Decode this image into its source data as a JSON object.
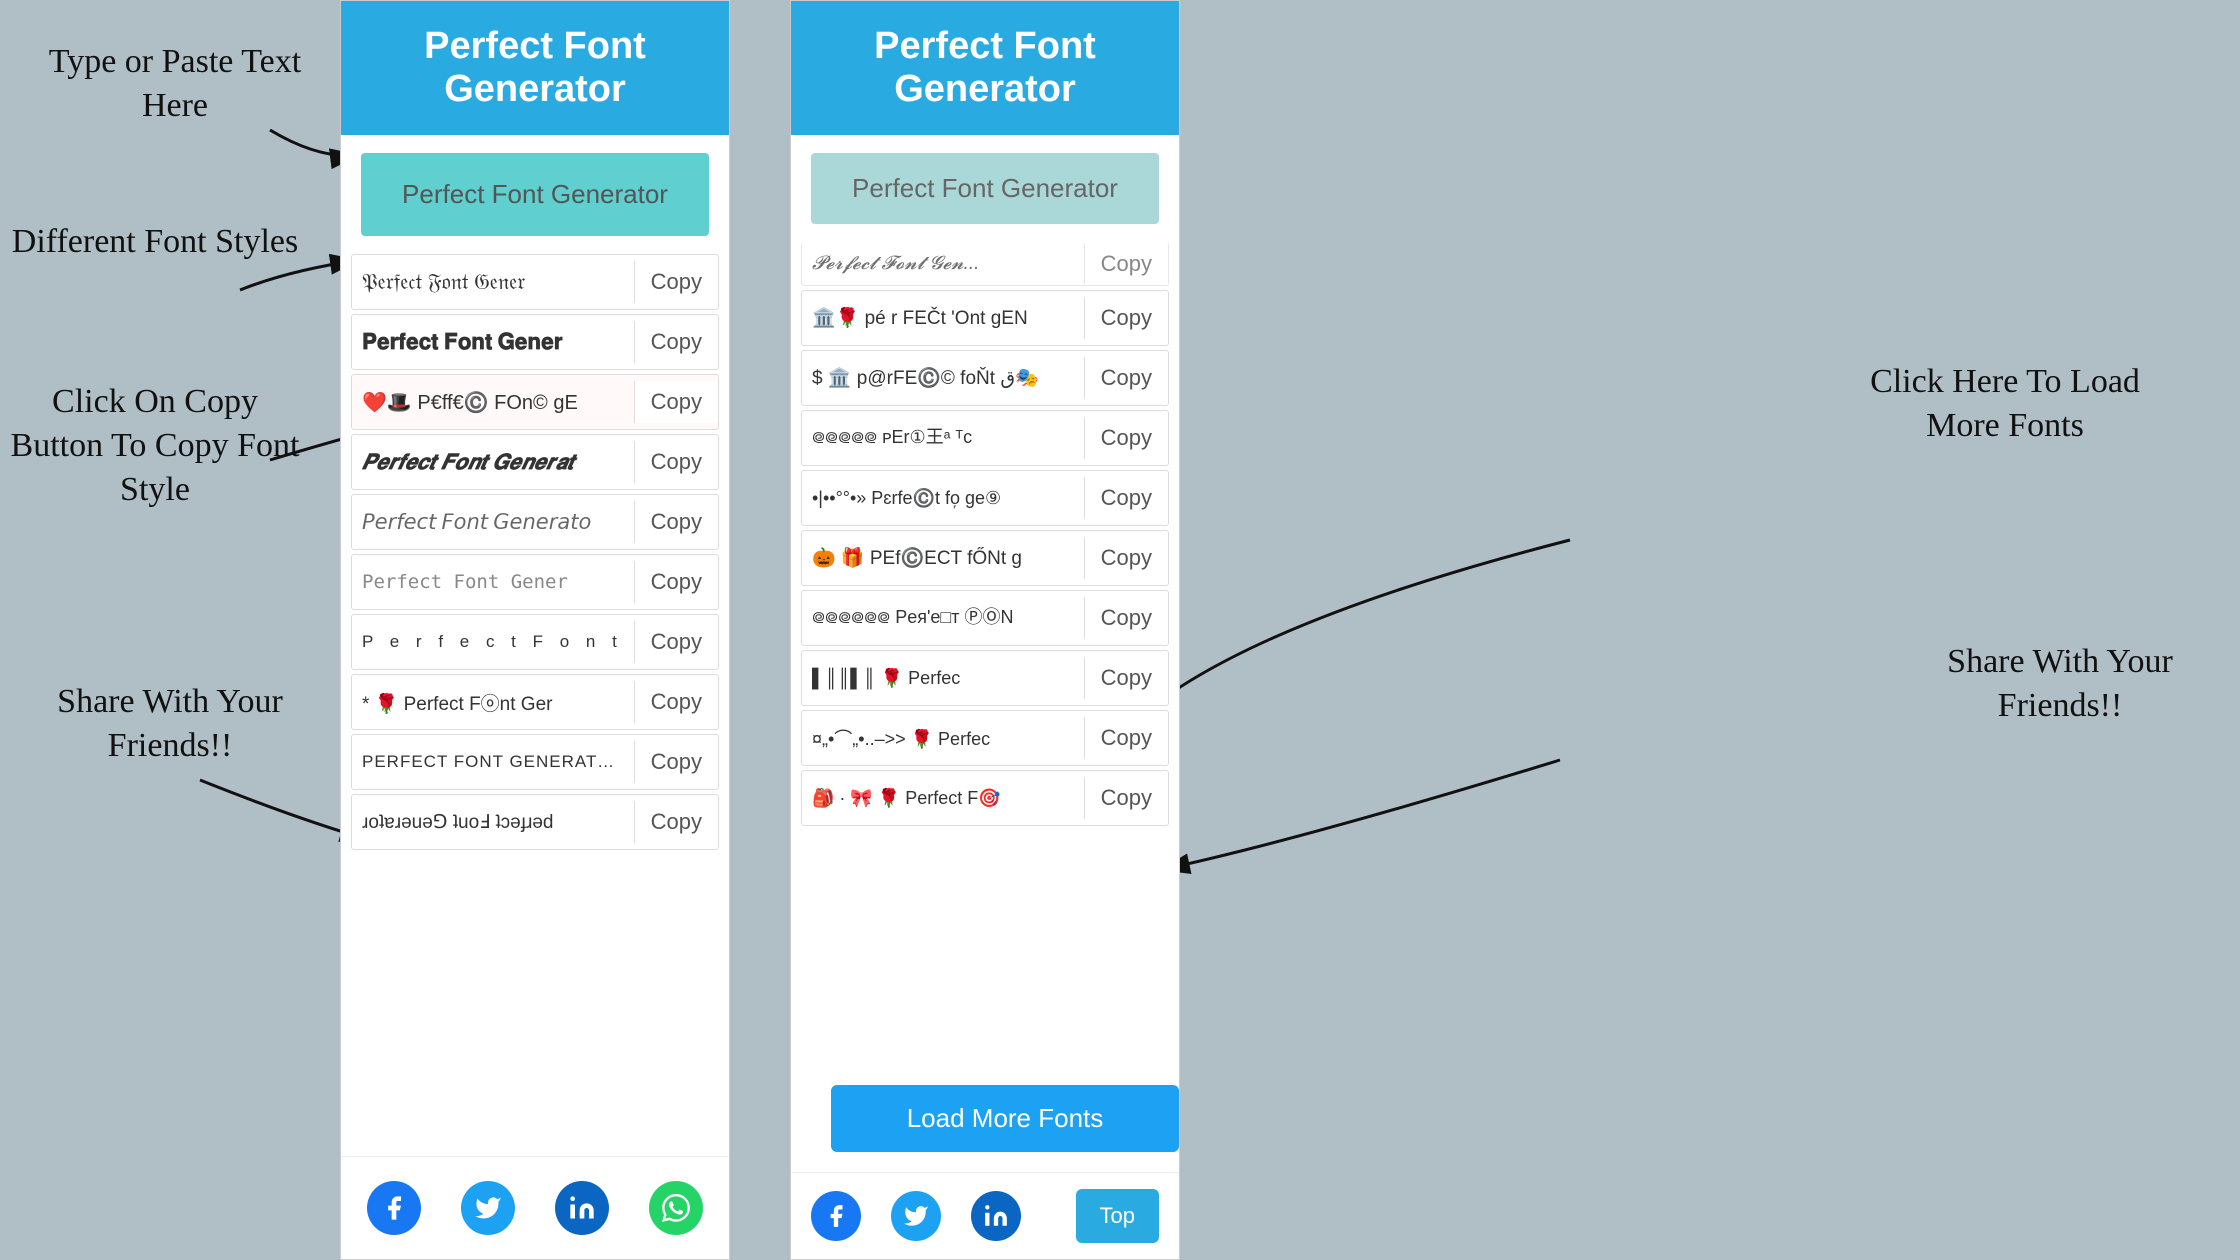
{
  "app": {
    "title": "Perfect Font Generator",
    "input_placeholder": "Perfect Font Generator",
    "header_color": "#29abe2",
    "bg_color": "#b0bec5"
  },
  "annotations": {
    "type_paste": "Type or Paste Text Here",
    "diff_fonts": "Different Font Styles",
    "click_copy": "Click On Copy Button To Copy Font Style",
    "share": "Share With Your Friends!!",
    "load_more": "Click Here To Load More Fonts",
    "share2": "Share With Your Friends!!"
  },
  "left_panel": {
    "header": "Perfect Font Generator",
    "input_value": "Perfect Font Generator",
    "fonts": [
      {
        "text": "𝔓𝔢𝔯𝔣𝔢𝔠𝔱 𝔉𝔬𝔫𝔱 𝔊𝔢𝔫𝔢𝔯𝔞𝔱𝔬𝔯",
        "style": "fraktur",
        "copy": "Copy"
      },
      {
        "text": "𝐏𝐞𝐫𝐟𝐞𝐜𝐭 𝐅𝐨𝐧𝐭 𝐆𝐞𝐧𝐞𝐫𝐚𝐭𝐨𝐫",
        "style": "bold-serif",
        "copy": "Copy"
      },
      {
        "text": "❤️🎩 P€ff€©️ FOn© gE",
        "style": "emoji",
        "copy": "Copy"
      },
      {
        "text": "𝑷𝒆𝒓𝒇𝒆𝒄𝒕 𝑭𝒐𝒏𝒕 𝑮𝒆𝒏𝒆𝒓𝒂𝒕",
        "style": "bold-italic",
        "copy": "Copy"
      },
      {
        "text": "𝘗𝘦𝘳𝘧𝘦𝘤𝘵 𝘍𝘰𝘯𝘵 𝘎𝘦𝘯𝘦𝘳𝘢𝘵𝘰",
        "style": "sans-italic",
        "copy": "Copy"
      },
      {
        "text": "𝙿𝚎𝚛𝚏𝚎𝚌𝚝 𝙵𝚘𝚗𝚝 𝙶𝚎𝚗𝚎𝚛",
        "style": "mono",
        "copy": "Copy"
      },
      {
        "text": "P e r f e c t  F o n t",
        "style": "spaced",
        "copy": "Copy"
      },
      {
        "text": "* 🌹 Perfect Fⓞnt Ger",
        "style": "emoji2",
        "copy": "Copy"
      },
      {
        "text": "PERFECT FONT GENERATOR",
        "style": "uppercase",
        "copy": "Copy"
      },
      {
        "text": "ɹoʇɐɹǝuǝ⅁ ʇuoℲ ʇɔǝɟɹǝd",
        "style": "flipped",
        "copy": "Copy"
      }
    ],
    "share_icons": [
      "facebook",
      "twitter",
      "linkedin",
      "whatsapp"
    ]
  },
  "right_panel": {
    "header": "Perfect Font Generator",
    "input_value": "Perfect Font Generator",
    "fonts": [
      {
        "text": "𝓟𝓮𝓻𝓯𝓮𝓬𝓽 𝓕𝓸𝓷𝓽 𝓖𝓮𝓷...",
        "style": "script",
        "copy": "Copy"
      },
      {
        "text": "🏛️🌹 pé r FEČt 'Ont gEN",
        "style": "emoji3",
        "copy": "Copy"
      },
      {
        "text": "$ 🏛️ p@rFE©️© foŇt ق🎭",
        "style": "emoji4",
        "copy": "Copy"
      },
      {
        "text": "᪤᪤᪤᪤᪤ ᴘEr①王ᵃ ᵀc",
        "style": "special1",
        "copy": "Copy"
      },
      {
        "text": "•|••°°•» Pɛrfe©️t fo᷊ ge⑨",
        "style": "special2",
        "copy": "Copy"
      },
      {
        "text": "🎃 🎁 PEf©️ECT fŐNt g",
        "style": "emoji5",
        "copy": "Copy"
      },
      {
        "text": "᪤᪤᪤᪤᪤᪤ Pея'e□т ⓅⓄN",
        "style": "special3",
        "copy": "Copy"
      },
      {
        "text": "▌║║▌║ 🌹 Perfec",
        "style": "barcode",
        "copy": "Copy"
      },
      {
        "text": "¤„•⌒„•..–>> 🌹 Perfec",
        "style": "special4",
        "copy": "Copy"
      },
      {
        "text": "🎒 · 🎀 🌹 Perfect F🎯",
        "style": "emoji6",
        "copy": "Copy"
      }
    ],
    "load_more_label": "Load More Fonts",
    "top_label": "Top",
    "share_icons": [
      "facebook",
      "twitter",
      "linkedin"
    ]
  },
  "copy_label": "Copy",
  "colors": {
    "header": "#29abe2",
    "input_bg": "#5fcfcf",
    "load_more_btn": "#1da1f2",
    "top_btn": "#29abe2"
  }
}
